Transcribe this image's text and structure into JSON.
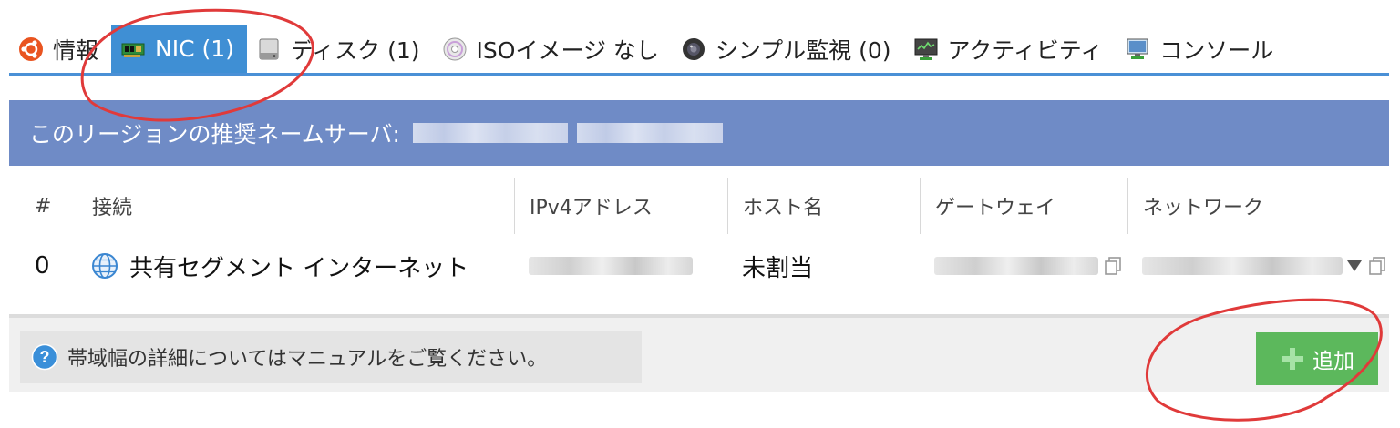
{
  "tabs": [
    {
      "label": "情報",
      "icon": "ubuntu-icon",
      "active": false
    },
    {
      "label": "NIC (1)",
      "icon": "network-card-icon",
      "active": true
    },
    {
      "label": "ディスク (1)",
      "icon": "disk-drive-icon",
      "active": false
    },
    {
      "label": "ISOイメージ なし",
      "icon": "cd-icon",
      "active": false
    },
    {
      "label": "シンプル監視 (0)",
      "icon": "camera-lens-icon",
      "active": false
    },
    {
      "label": "アクティビティ",
      "icon": "monitor-activity-icon",
      "active": false
    },
    {
      "label": "コンソール",
      "icon": "console-monitor-icon",
      "active": false
    }
  ],
  "banner": {
    "label": "このリージョンの推奨ネームサーバ:"
  },
  "table": {
    "headers": [
      "#",
      "接続",
      "IPv4アドレス",
      "ホスト名",
      "ゲートウェイ",
      "ネットワーク"
    ],
    "rows": [
      {
        "index": "0",
        "connection": "共有セグメント インターネット",
        "hostname": "未割当"
      }
    ]
  },
  "footer": {
    "help_text": "帯域幅の詳細についてはマニュアルをご覧ください。",
    "add_label": "追加"
  },
  "colors": {
    "tab_active": "#3f8fd4",
    "banner": "#6f8bc6",
    "add_button": "#5cb85c",
    "annotation": "#e03a3a"
  }
}
